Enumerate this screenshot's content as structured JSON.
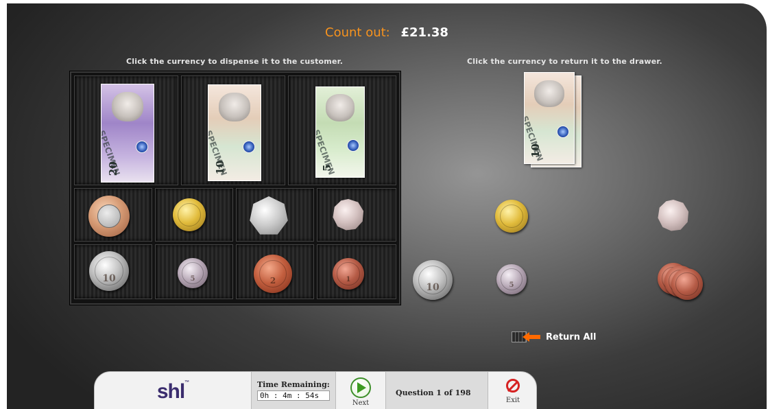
{
  "header": {
    "count_label": "Count out:",
    "count_value": "£21.38"
  },
  "instructions": {
    "dispense": "Click the currency to dispense it to the customer.",
    "return": "Click the currency to return it to the drawer."
  },
  "drawer": {
    "notes": [
      {
        "denomination": "£20",
        "label": "20",
        "icon": "twenty-pound-note"
      },
      {
        "denomination": "£10",
        "label": "10",
        "icon": "ten-pound-note"
      },
      {
        "denomination": "£5",
        "label": "5",
        "icon": "five-pound-note"
      }
    ],
    "coins_top": [
      {
        "denomination": "£2",
        "icon": "two-pound-coin"
      },
      {
        "denomination": "£1",
        "icon": "one-pound-coin"
      },
      {
        "denomination": "50p",
        "icon": "fifty-pence-coin"
      },
      {
        "denomination": "20p",
        "icon": "twenty-pence-coin"
      }
    ],
    "coins_bottom": [
      {
        "denomination": "10p",
        "label": "10",
        "icon": "ten-pence-coin"
      },
      {
        "denomination": "5p",
        "label": "5",
        "icon": "five-pence-coin"
      },
      {
        "denomination": "2p",
        "label": "2",
        "icon": "two-pence-coin"
      },
      {
        "denomination": "1p",
        "label": "1",
        "icon": "one-penny-coin"
      }
    ]
  },
  "dispensed": {
    "notes": [
      {
        "denomination": "£10",
        "label": "10",
        "count": 2
      }
    ],
    "coins": [
      {
        "denomination": "£1",
        "count": 1
      },
      {
        "denomination": "20p",
        "count": 1
      },
      {
        "denomination": "10p",
        "label": "10",
        "count": 1
      },
      {
        "denomination": "5p",
        "label": "5",
        "count": 1
      },
      {
        "denomination": "1p",
        "count": 3
      }
    ]
  },
  "return_all": {
    "label": "Return All",
    "icon": "return-all-icon"
  },
  "footer": {
    "logo": "shl",
    "logo_mark": "™",
    "time_label": "Time Remaining:",
    "time_value": "0h : 4m : 54s",
    "next_label": "Next",
    "question": "Question 1 of 198",
    "exit_label": "Exit"
  },
  "colors": {
    "accent": "#f7931e",
    "next_green": "#3d9b22",
    "exit_red": "#d62222",
    "logo_purple": "#3b2d6e"
  }
}
